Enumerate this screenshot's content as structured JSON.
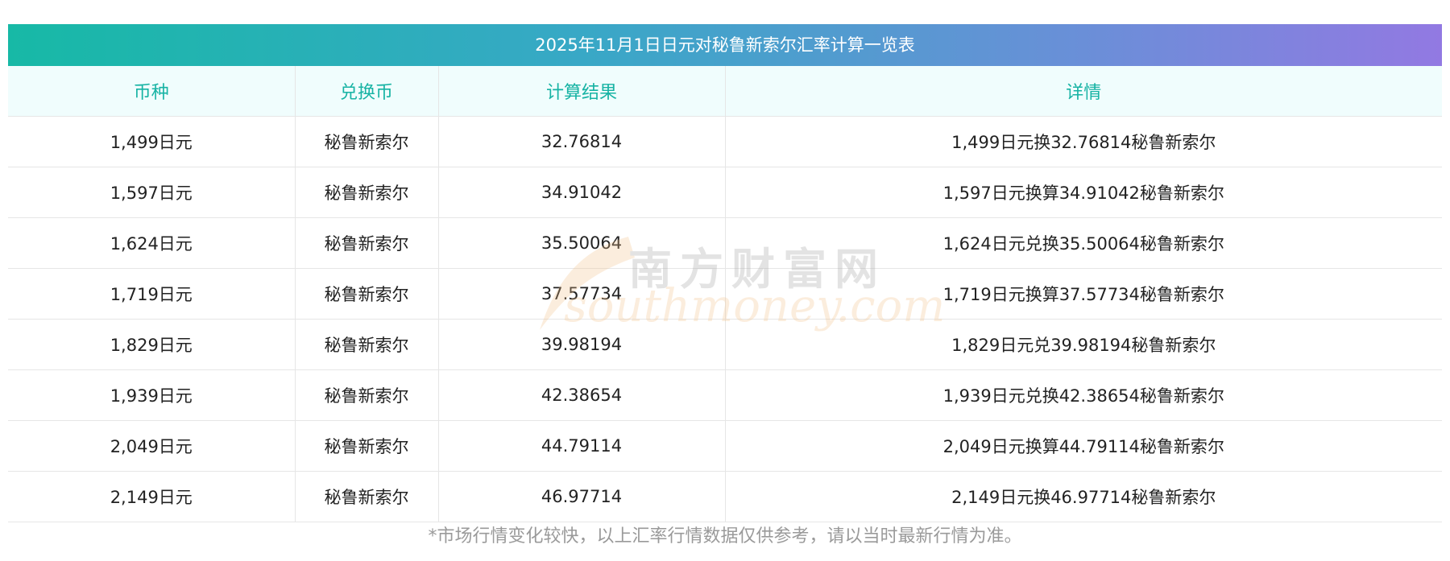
{
  "title": "2025年11月1日日元对秘鲁新索尔汇率计算一览表",
  "headers": [
    "币种",
    "兑换币",
    "计算结果",
    "详情"
  ],
  "rows": [
    [
      "1,499日元",
      "秘鲁新索尔",
      "32.76814",
      "1,499日元换32.76814秘鲁新索尔"
    ],
    [
      "1,597日元",
      "秘鲁新索尔",
      "34.91042",
      "1,597日元换算34.91042秘鲁新索尔"
    ],
    [
      "1,624日元",
      "秘鲁新索尔",
      "35.50064",
      "1,624日元兑换35.50064秘鲁新索尔"
    ],
    [
      "1,719日元",
      "秘鲁新索尔",
      "37.57734",
      "1,719日元换算37.57734秘鲁新索尔"
    ],
    [
      "1,829日元",
      "秘鲁新索尔",
      "39.98194",
      "1,829日元兑39.98194秘鲁新索尔"
    ],
    [
      "1,939日元",
      "秘鲁新索尔",
      "42.38654",
      "1,939日元兑换42.38654秘鲁新索尔"
    ],
    [
      "2,049日元",
      "秘鲁新索尔",
      "44.79114",
      "2,049日元换算44.79114秘鲁新索尔"
    ],
    [
      "2,149日元",
      "秘鲁新索尔",
      "46.97714",
      "2,149日元换46.97714秘鲁新索尔"
    ]
  ],
  "footnote": "*市场行情变化较快，以上汇率行情数据仅供参考，请以当时最新行情为准。",
  "watermark": {
    "cn": "南方财富网",
    "en": "southmoney.com"
  },
  "colors": {
    "header_text": "#17b3a4",
    "title_gradient_start": "#17b9a6",
    "title_gradient_end": "#9279e2"
  }
}
